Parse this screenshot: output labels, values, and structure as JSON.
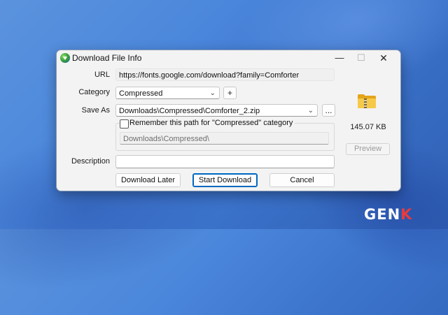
{
  "window": {
    "title": "Download File Info",
    "controls": {
      "minimize": "—",
      "maximize": "☐",
      "close": "✕"
    }
  },
  "form": {
    "url_label": "URL",
    "url_value": "https://fonts.google.com/download?family=Comforter",
    "category_label": "Category",
    "category_value": "Compressed",
    "add_category": "+",
    "save_as_label": "Save As",
    "save_as_value": "Downloads\\Compressed\\Comforter_2.zip",
    "browse": "...",
    "remember_label": "Remember this path for \"Compressed\" category",
    "remember_checked": false,
    "remember_path": "Downloads\\Compressed\\",
    "description_label": "Description",
    "description_value": ""
  },
  "side": {
    "file_icon": "zip-folder-icon",
    "size": "145.07  KB",
    "preview": "Preview"
  },
  "buttons": {
    "download_later": "Download Later",
    "start_download": "Start Download",
    "cancel": "Cancel"
  },
  "watermark": {
    "logo_main": "GEN",
    "logo_accent": "K"
  },
  "colors": {
    "accent": "#0067c0",
    "desktop": "#4a86db",
    "folder": "#f7c948"
  }
}
